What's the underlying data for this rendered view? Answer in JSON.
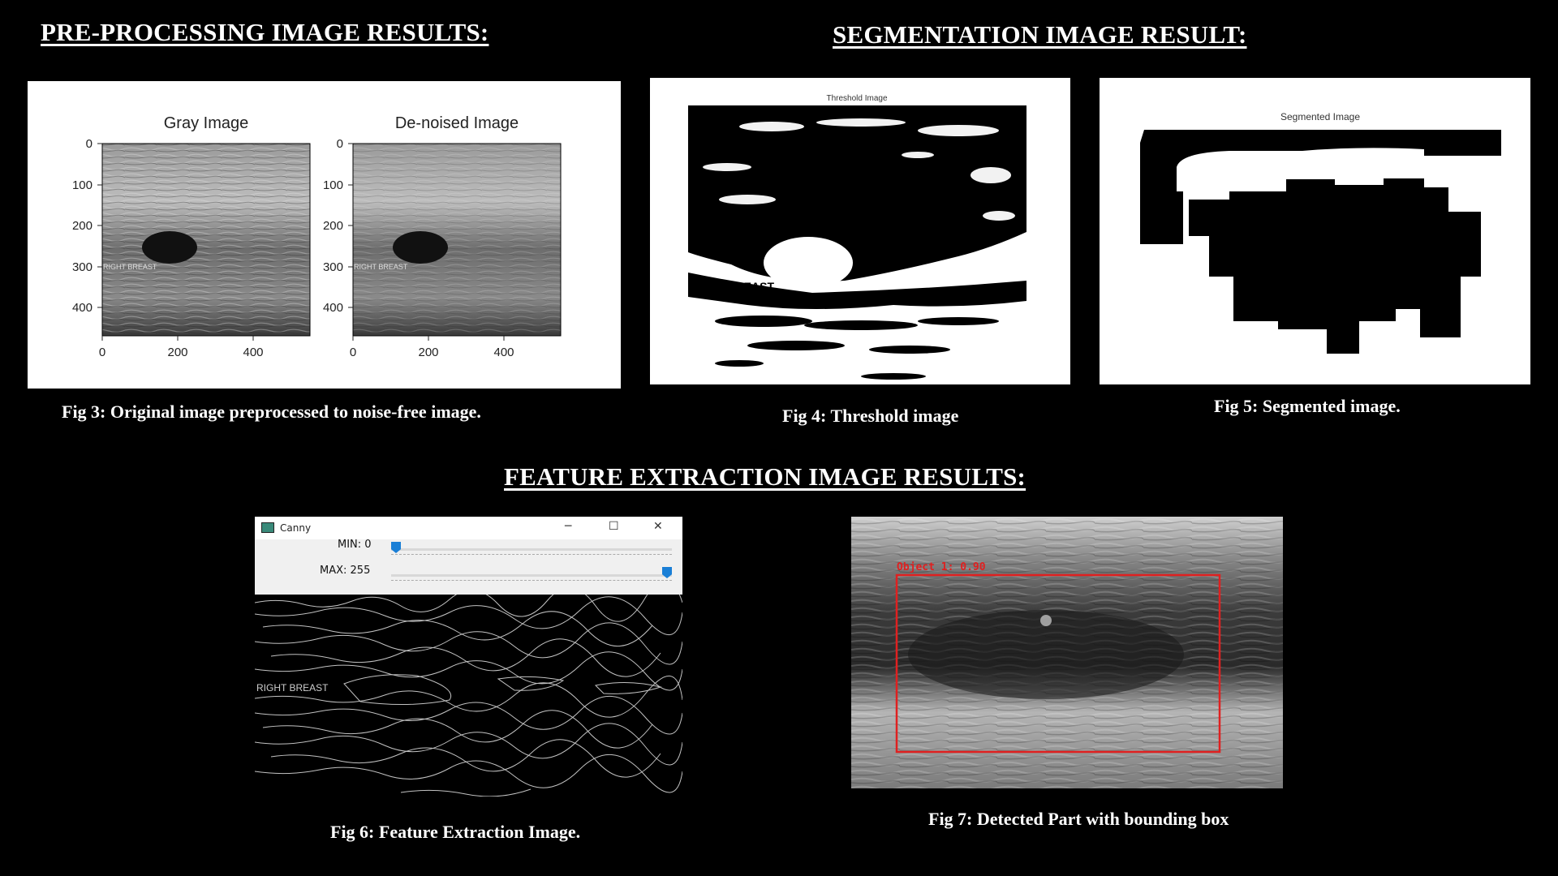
{
  "headings": {
    "preprocessing": "PRE-PROCESSING IMAGE RESULTS:",
    "segmentation": "SEGMENTATION IMAGE RESULT:",
    "feature": "FEATURE EXTRACTION IMAGE RESULTS:"
  },
  "fig3": {
    "caption": "Fig 3: Original image preprocessed to noise-free image.",
    "left_title": "Gray Image",
    "right_title": "De-noised Image",
    "y_ticks": [
      "0",
      "100",
      "200",
      "300",
      "400"
    ],
    "x_ticks": [
      "0",
      "200",
      "400"
    ],
    "overlay_text": "RIGHT BREAST"
  },
  "fig4": {
    "caption": "Fig 4: Threshold image",
    "title": "Threshold Image",
    "overlay_text": "RIGHT BREAST"
  },
  "fig5": {
    "caption": "Fig 5: Segmented image.",
    "title": "Segmented Image"
  },
  "fig6": {
    "caption": "Fig 6: Feature Extraction Image.",
    "window_title": "Canny",
    "min_label": "MIN: 0",
    "max_label": "MAX: 255",
    "min_value": 0,
    "max_value": 255,
    "overlay_text": "RIGHT BREAST",
    "slider_color": "#1a7fd6"
  },
  "fig7": {
    "caption": "Fig 7: Detected Part with bounding box",
    "detection_label": "Object 1: 0.90",
    "box_color": "#e02020"
  }
}
